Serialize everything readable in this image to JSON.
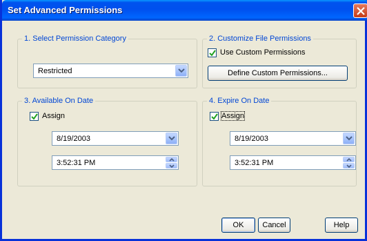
{
  "window": {
    "title": "Set Advanced Permissions"
  },
  "category_group": {
    "legend": "1. Select Permission Category",
    "selected": "Restricted"
  },
  "custom_group": {
    "legend": "2. Customize File Permissions",
    "use_custom_label": "Use Custom Permissions",
    "use_custom_checked": true,
    "define_button": "Define Custom Permissions..."
  },
  "available_group": {
    "legend": "3. Available On Date",
    "assign_label": "Assign",
    "assign_checked": true,
    "date": "8/19/2003",
    "time": "3:52:31 PM"
  },
  "expire_group": {
    "legend": "4. Expire On Date",
    "assign_label": "Assign",
    "assign_checked": true,
    "date": "8/19/2003",
    "time": "3:52:31 PM"
  },
  "buttons": {
    "ok": "OK",
    "cancel": "Cancel",
    "help": "Help"
  },
  "colors": {
    "legend_text": "#0046d5",
    "titlebar": "#0053ee",
    "dialog_bg": "#ece9d8"
  },
  "icons": {
    "close": "close-icon",
    "dropdown": "chevron-down-icon",
    "spin_up": "chevron-up-icon",
    "spin_down": "chevron-down-icon",
    "check": "checkmark-icon"
  }
}
